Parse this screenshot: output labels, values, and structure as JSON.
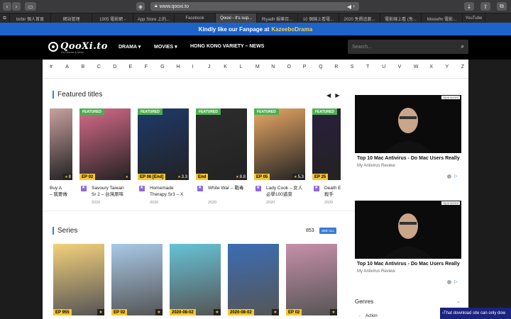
{
  "browser": {
    "url": "www.qooxi.to",
    "tabs": [
      "birbir 個人首頁",
      "網站管理",
      "1905 電影網 -",
      "App Store 上的...",
      "Facebook",
      "Qooxi - It's sup...",
      "Riyadh 娛樂百...",
      "10 個線上看電...",
      "2020 免費追劇...",
      "電影線上看 (免...",
      "Moviefm 電影...",
      "YouTube"
    ],
    "active_tab_index": 5
  },
  "fanbar": {
    "text": "Kindly like our Fanpage at",
    "highlight": "KazeeboDrama"
  },
  "site": {
    "logo": "QooXi.to",
    "logo_sub": "It's Drama & More",
    "nav": [
      "DRAMA ▾",
      "MOVIES ▾",
      "HONG KONG VARIETY – NEWS"
    ],
    "search_placeholder": "Search..."
  },
  "alphabet": [
    "#",
    "A",
    "B",
    "C",
    "D",
    "E",
    "F",
    "G",
    "H",
    "I",
    "J",
    "K",
    "L",
    "M",
    "N",
    "O",
    "P",
    "Q",
    "R",
    "S",
    "T",
    "U",
    "V",
    "W",
    "X",
    "Y",
    "Z"
  ],
  "featured": {
    "title": "Featured titles",
    "items": [
      {
        "badge": "",
        "ep": "",
        "rating": "8",
        "title_l1": "Buy A",
        "title_l2": "– 我要做",
        "year": "",
        "color": "#c9a0a0"
      },
      {
        "badge": "FEATURED",
        "ep": "EP 02",
        "rating": "★",
        "title_l1": "Savoury Taiwan",
        "title_l2": "Sr 2 – 台灣原味",
        "year": "2020",
        "color": "#d86b8a"
      },
      {
        "badge": "FEATURED",
        "ep": "EP 06 [End]",
        "rating": "3.3",
        "title_l1": "Homemade",
        "title_l2": "Therapy Sr3 – X",
        "year": "2020",
        "color": "#1e3a6b"
      },
      {
        "badge": "FEATURED",
        "ep": "End",
        "rating": "8.8",
        "title_l1": "White War – 戰毒",
        "title_l2": "",
        "year": "2020",
        "color": "#2d2d2d"
      },
      {
        "badge": "FEATURED",
        "ep": "EP 05",
        "rating": "5.3",
        "title_l1": "Lady Cook – 女人",
        "title_l2": "必學100道菜",
        "year": "2020",
        "color": "#e9a866"
      },
      {
        "badge": "FEATURED",
        "ep": "EP 25",
        "rating": "",
        "title_l1": "Death E",
        "title_l2": "殺手",
        "year": "2020",
        "color": "#2a1f3d"
      }
    ]
  },
  "series": {
    "title": "Series",
    "count": "853",
    "see_all": "SEE ALL",
    "items": [
      {
        "ep": "EP 955",
        "color": "#f3d07a"
      },
      {
        "ep": "EP 02",
        "color": "#a8c9e8"
      },
      {
        "ep": "2020-08-02",
        "color": "#66c2d6"
      },
      {
        "ep": "2020-08-02",
        "color": "#3b6db5"
      },
      {
        "ep": "EP 02",
        "color": "#c78fa9"
      }
    ]
  },
  "ads": [
    {
      "label": "Sponsored",
      "title": "Top 10 Mac Antivirus - Do Mac Users Really",
      "sub": "My Antivirus Review"
    },
    {
      "label": "Sponsored",
      "title": "Top 10 Mac Antivirus - Do Mac Users Really",
      "sub": "My Antivirus Review"
    }
  ],
  "genres": {
    "title": "Genres",
    "first": "Action"
  },
  "toast": "That download site can only dow"
}
